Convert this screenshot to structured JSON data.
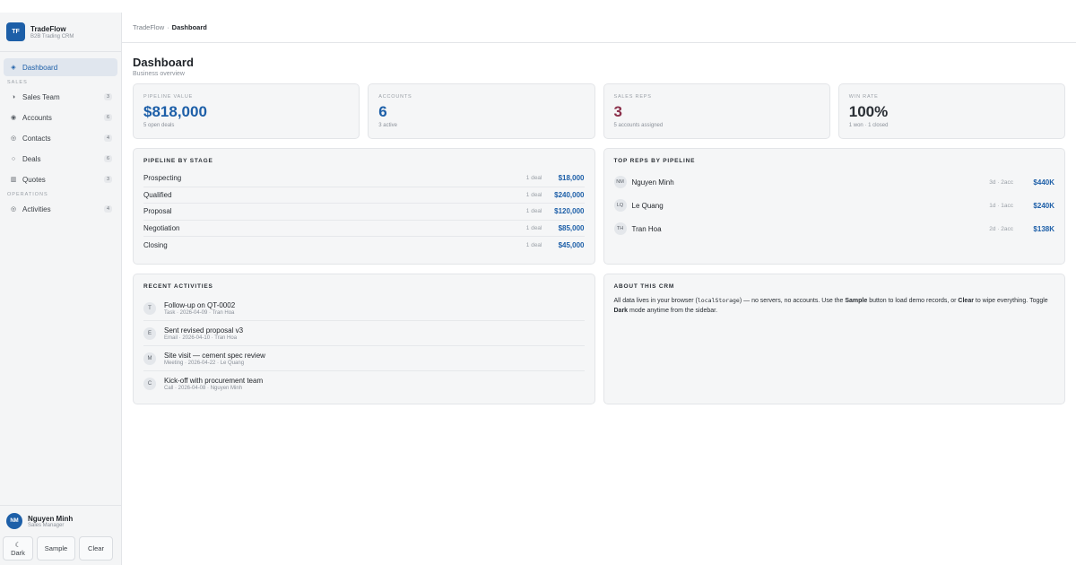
{
  "brand": {
    "logo": "TF",
    "name": "TradeFlow",
    "subtitle": "B2B Trading CRM"
  },
  "nav": {
    "dashboard": {
      "label": "Dashboard",
      "icon": "diamond-icon"
    },
    "sales_section": "SALES",
    "sales_items": [
      {
        "label": "Sales Team",
        "count": "3",
        "icon": "half-circle-icon"
      },
      {
        "label": "Accounts",
        "count": "6",
        "icon": "filled-circle-icon"
      },
      {
        "label": "Contacts",
        "count": "4",
        "icon": "ring-icon"
      },
      {
        "label": "Deals",
        "count": "6",
        "icon": "circle-outline-icon"
      },
      {
        "label": "Quotes",
        "count": "3",
        "icon": "document-icon"
      }
    ],
    "ops_section": "OPERATIONS",
    "ops_items": [
      {
        "label": "Activities",
        "count": "4",
        "icon": "target-icon"
      }
    ]
  },
  "user": {
    "initials": "NM",
    "name": "Nguyen Minh",
    "role": "Sales Manager"
  },
  "actions": {
    "dark_icon": "☾",
    "dark": "Dark",
    "sample": "Sample",
    "clear": "Clear"
  },
  "breadcrumb": {
    "root": "TradeFlow",
    "sep": "·",
    "current": "Dashboard"
  },
  "page": {
    "title": "Dashboard",
    "subtitle": "Business overview"
  },
  "stats": [
    {
      "label": "PIPELINE VALUE",
      "value": "$818,000",
      "sub": "5 open deals",
      "color": "#1d5fa8"
    },
    {
      "label": "ACCOUNTS",
      "value": "6",
      "sub": "3 active",
      "color": "#1d5fa8"
    },
    {
      "label": "SALES REPS",
      "value": "3",
      "sub": "5 accounts assigned",
      "color": "#8b2f4a"
    },
    {
      "label": "WIN RATE",
      "value": "100%",
      "sub": "1 won · 1 closed",
      "color": "#2a2f35"
    }
  ],
  "pipeline": {
    "title": "PIPELINE BY STAGE",
    "stages": [
      {
        "name": "Prospecting",
        "deals": "1 deal",
        "value": "$18,000"
      },
      {
        "name": "Qualified",
        "deals": "1 deal",
        "value": "$240,000"
      },
      {
        "name": "Proposal",
        "deals": "1 deal",
        "value": "$120,000"
      },
      {
        "name": "Negotiation",
        "deals": "1 deal",
        "value": "$85,000"
      },
      {
        "name": "Closing",
        "deals": "1 deal",
        "value": "$45,000"
      }
    ]
  },
  "top_reps": {
    "title": "TOP REPS BY PIPELINE",
    "reps": [
      {
        "initials": "NM",
        "name": "Nguyen Minh",
        "meta": "3d · 2acc",
        "value": "$440K"
      },
      {
        "initials": "LQ",
        "name": "Le Quang",
        "meta": "1d · 1acc",
        "value": "$240K"
      },
      {
        "initials": "TH",
        "name": "Tran Hoa",
        "meta": "2d · 2acc",
        "value": "$138K"
      }
    ]
  },
  "activities": {
    "title": "RECENT ACTIVITIES",
    "items": [
      {
        "initial": "T",
        "title": "Follow-up on QT-0002",
        "meta": "Task · 2026-04-09 · Tran Hoa"
      },
      {
        "initial": "E",
        "title": "Sent revised proposal v3",
        "meta": "Email · 2026-04-10 · Tran Hoa"
      },
      {
        "initial": "M",
        "title": "Site visit — cement spec review",
        "meta": "Meeting · 2026-04-22 · Le Quang"
      },
      {
        "initial": "C",
        "title": "Kick-off with procurement team",
        "meta": "Call · 2026-04-08 · Nguyen Minh"
      }
    ]
  },
  "about": {
    "title": "ABOUT THIS CRM",
    "p1": "All data lives in your browser (",
    "code": "localStorage",
    "p2": ") — no servers, no accounts. Use the ",
    "b1": "Sample",
    "p3": " button to load demo records, or ",
    "b2": "Clear",
    "p4": " to wipe everything. Toggle ",
    "b3": "Dark",
    "p5": " mode anytime from the sidebar."
  }
}
